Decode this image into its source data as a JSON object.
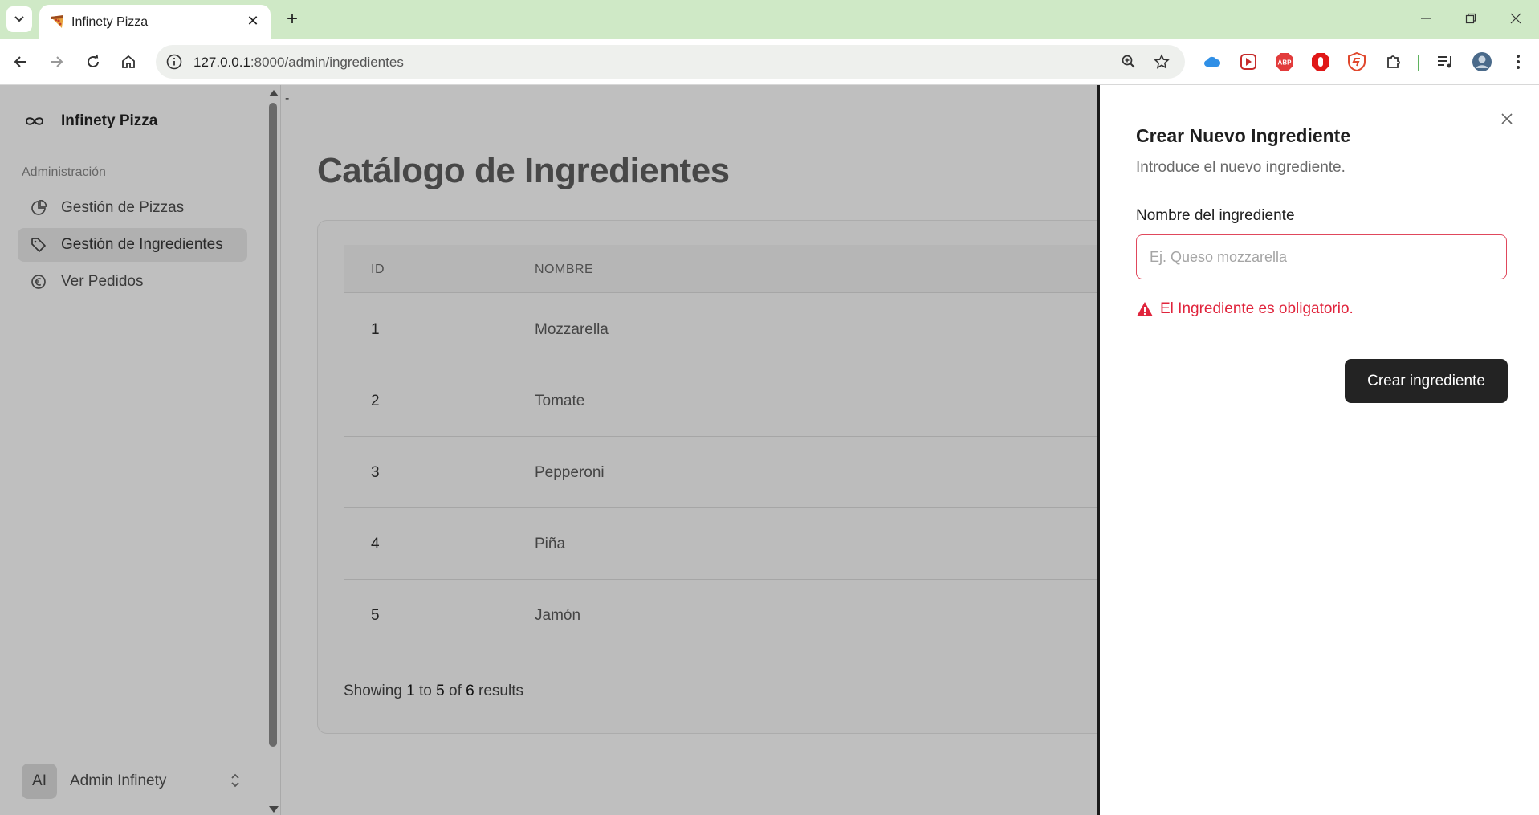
{
  "browser": {
    "tab_title": "Infinety Pizza",
    "url_host": "127.0.0.1",
    "url_rest": ":8000/admin/ingredientes"
  },
  "sidebar": {
    "brand": "Infinety Pizza",
    "section_label": "Administración",
    "items": [
      {
        "label": "Gestión de Pizzas",
        "icon": "pie-chart-icon",
        "active": false
      },
      {
        "label": "Gestión de Ingredientes",
        "icon": "tag-icon",
        "active": true
      },
      {
        "label": "Ver Pedidos",
        "icon": "euro-icon",
        "active": false
      }
    ],
    "user": {
      "initials": "AI",
      "name": "Admin Infinety"
    }
  },
  "main": {
    "title": "Catálogo de Ingredientes",
    "columns": [
      "ID",
      "NOMBRE"
    ],
    "rows": [
      {
        "id": "1",
        "name": "Mozzarella"
      },
      {
        "id": "2",
        "name": "Tomate"
      },
      {
        "id": "3",
        "name": "Pepperoni"
      },
      {
        "id": "4",
        "name": "Piña"
      },
      {
        "id": "5",
        "name": "Jamón"
      }
    ],
    "results": {
      "prefix": "Showing",
      "from": "1",
      "to_word": "to",
      "to": "5",
      "of_word": "of",
      "total": "6",
      "suffix": "results"
    }
  },
  "panel": {
    "title": "Crear Nuevo Ingrediente",
    "subtitle": "Introduce el nuevo ingrediente.",
    "field_label": "Nombre del ingrediente",
    "field_value": "",
    "field_placeholder": "Ej. Queso mozzarella",
    "error": "El Ingrediente es obligatorio.",
    "submit_label": "Crear ingrediente"
  },
  "colors": {
    "tabbar": "#cfe9c6",
    "overlay": "#bfbfbf",
    "error": "#e0243c",
    "primary_button": "#232323"
  }
}
